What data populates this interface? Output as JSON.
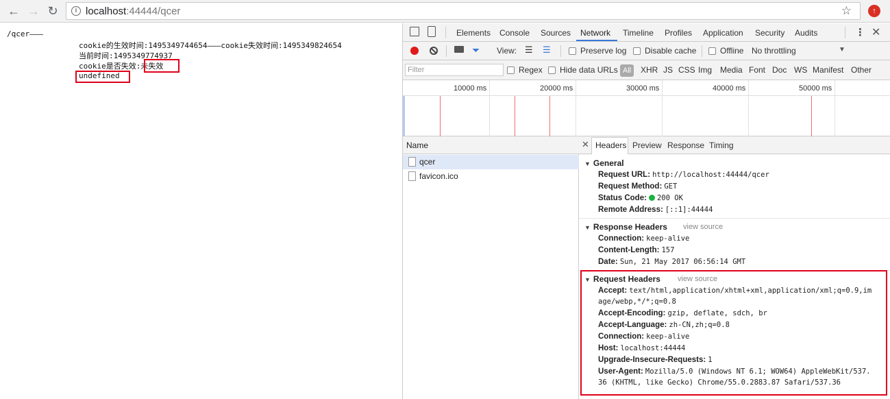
{
  "browser": {
    "url_host": "localhost",
    "url_rest": ":44444/qcer"
  },
  "page": {
    "path_line": "/qcer———",
    "line1": "cookie的生效时间:1495349744654———cookie失效时间:1495349824654",
    "line2": "当前时间:1495349774937",
    "line3_prefix": "cookie是否失效:",
    "line3_value": "未失效",
    "line4": "undefined"
  },
  "devtools": {
    "tabs": [
      "Elements",
      "Console",
      "Sources",
      "Network",
      "Timeline",
      "Profiles",
      "Application",
      "Security",
      "Audits"
    ],
    "active_tab": "Network",
    "controls": {
      "view_label": "View:",
      "preserve_log": "Preserve log",
      "disable_cache": "Disable cache",
      "offline": "Offline",
      "throttling": "No throttling"
    },
    "filter": {
      "placeholder": "Filter",
      "regex": "Regex",
      "hide_data_urls": "Hide data URLs",
      "types": [
        "All",
        "XHR",
        "JS",
        "CSS",
        "Img",
        "Media",
        "Font",
        "Doc",
        "WS",
        "Manifest",
        "Other"
      ]
    },
    "overview_ticks": [
      "10000 ms",
      "20000 ms",
      "30000 ms",
      "40000 ms",
      "50000 ms"
    ],
    "names_header": "Name",
    "requests": [
      "qcer",
      "favicon.ico"
    ],
    "detail_tabs": [
      "Headers",
      "Preview",
      "Response",
      "Timing"
    ],
    "general": {
      "title": "General",
      "request_url_k": "Request URL:",
      "request_url_v": "http://localhost:44444/qcer",
      "request_method_k": "Request Method:",
      "request_method_v": "GET",
      "status_code_k": "Status Code:",
      "status_code_v": "200 OK",
      "remote_address_k": "Remote Address:",
      "remote_address_v": "[::1]:44444"
    },
    "response_headers": {
      "title": "Response Headers",
      "view_source": "view source",
      "connection_k": "Connection:",
      "connection_v": "keep-alive",
      "content_length_k": "Content-Length:",
      "content_length_v": "157",
      "date_k": "Date:",
      "date_v": "Sun, 21 May 2017 06:56:14 GMT"
    },
    "request_headers": {
      "title": "Request Headers",
      "view_source": "view source",
      "accept_k": "Accept:",
      "accept_v": "text/html,application/xhtml+xml,application/xml;q=0.9,im",
      "accept_v2": "age/webp,*/*;q=0.8",
      "accept_encoding_k": "Accept-Encoding:",
      "accept_encoding_v": "gzip, deflate, sdch, br",
      "accept_language_k": "Accept-Language:",
      "accept_language_v": "zh-CN,zh;q=0.8",
      "connection_k": "Connection:",
      "connection_v": "keep-alive",
      "host_k": "Host:",
      "host_v": "localhost:44444",
      "upgrade_k": "Upgrade-Insecure-Requests:",
      "upgrade_v": "1",
      "user_agent_k": "User-Agent:",
      "user_agent_v": "Mozilla/5.0 (Windows NT 6.1; WOW64) AppleWebKit/537.",
      "user_agent_v2": "36 (KHTML, like Gecko) Chrome/55.0.2883.87 Safari/537.36"
    }
  },
  "colors": {
    "highlight_red": "#e0001a",
    "record_red": "#e01a1a",
    "status_green": "#1ab240",
    "selected_row": "#dfe8f6"
  }
}
